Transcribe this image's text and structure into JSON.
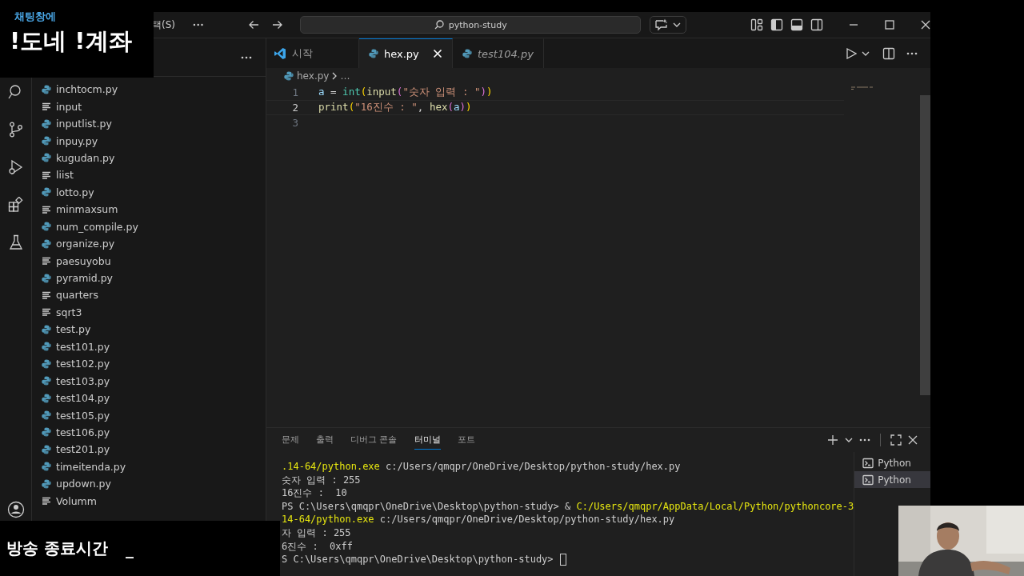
{
  "overlay_top": {
    "caption": "채팅창에",
    "headline": "!도네 !계좌"
  },
  "title_bar": {
    "menu_item": "택(S)",
    "search": "python-study"
  },
  "explorer": {
    "files": [
      {
        "name": "inchtocm.py",
        "kind": "python"
      },
      {
        "name": "input",
        "kind": "text"
      },
      {
        "name": "inputlist.py",
        "kind": "python"
      },
      {
        "name": "inpuy.py",
        "kind": "python"
      },
      {
        "name": "kugudan.py",
        "kind": "python"
      },
      {
        "name": "liist",
        "kind": "text"
      },
      {
        "name": "lotto.py",
        "kind": "python"
      },
      {
        "name": "minmaxsum",
        "kind": "text"
      },
      {
        "name": "num_compile.py",
        "kind": "python"
      },
      {
        "name": "organize.py",
        "kind": "python"
      },
      {
        "name": "paesuyobu",
        "kind": "text"
      },
      {
        "name": "pyramid.py",
        "kind": "python"
      },
      {
        "name": "quarters",
        "kind": "text"
      },
      {
        "name": "sqrt3",
        "kind": "text"
      },
      {
        "name": "test.py",
        "kind": "python"
      },
      {
        "name": "test101.py",
        "kind": "python"
      },
      {
        "name": "test102.py",
        "kind": "python"
      },
      {
        "name": "test103.py",
        "kind": "python"
      },
      {
        "name": "test104.py",
        "kind": "python"
      },
      {
        "name": "test105.py",
        "kind": "python"
      },
      {
        "name": "test106.py",
        "kind": "python"
      },
      {
        "name": "test201.py",
        "kind": "python"
      },
      {
        "name": "timeitenda.py",
        "kind": "python"
      },
      {
        "name": "updown.py",
        "kind": "python"
      },
      {
        "name": "Volumm",
        "kind": "text"
      }
    ]
  },
  "tabs": [
    {
      "label": "시작",
      "kind": "welcome",
      "selected": false,
      "preview": false
    },
    {
      "label": "hex.py",
      "kind": "python",
      "selected": true,
      "preview": false
    },
    {
      "label": "test104.py",
      "kind": "python",
      "selected": false,
      "preview": true
    }
  ],
  "breadcrumb": {
    "file": "hex.py",
    "rest": "…"
  },
  "code": {
    "lines": [
      {
        "number": "1",
        "selected": false,
        "tokens": [
          {
            "text": "a",
            "kind": "var"
          },
          {
            "text": " = ",
            "kind": "plain"
          },
          {
            "text": "int",
            "kind": "builtin"
          },
          {
            "text": "(",
            "kind": "bracket1"
          },
          {
            "text": "input",
            "kind": "func"
          },
          {
            "text": "(",
            "kind": "bracket2"
          },
          {
            "text": "\"숫자 입력 : \"",
            "kind": "string"
          },
          {
            "text": ")",
            "kind": "bracket2"
          },
          {
            "text": ")",
            "kind": "bracket1"
          }
        ]
      },
      {
        "number": "2",
        "selected": true,
        "tokens": [
          {
            "text": "print",
            "kind": "func"
          },
          {
            "text": "(",
            "kind": "bracket1"
          },
          {
            "text": "\"16진수 : \"",
            "kind": "string"
          },
          {
            "text": ", ",
            "kind": "plain"
          },
          {
            "text": "hex",
            "kind": "func"
          },
          {
            "text": "(",
            "kind": "bracket2"
          },
          {
            "text": "a",
            "kind": "var"
          },
          {
            "text": ")",
            "kind": "bracket2"
          },
          {
            "text": ")",
            "kind": "bracket1"
          }
        ]
      },
      {
        "number": "3",
        "selected": false
      }
    ]
  },
  "panel": {
    "tabs": [
      {
        "label": "문제",
        "selected": false
      },
      {
        "label": "출력",
        "selected": false
      },
      {
        "label": "디버그 콘솔",
        "selected": false
      },
      {
        "label": "터미널",
        "selected": true
      },
      {
        "label": "포트",
        "selected": false
      }
    ],
    "terminal_lines": [
      [
        {
          "text": ".14-64/python.exe",
          "kind": "path"
        },
        {
          "text": " c:/Users/qmqpr/OneDrive/Desktop/python-study/hex.py",
          "kind": "text"
        }
      ],
      [
        {
          "text": "숫자 입력 : 255",
          "kind": "text"
        }
      ],
      [
        {
          "text": "16진수 :  10",
          "kind": "text"
        }
      ],
      [
        {
          "text": "PS C:\\Users\\qmqpr\\OneDrive\\Desktop\\python-study> & ",
          "kind": "text"
        },
        {
          "text": "C:/Users/qmqpr/AppData/Local/Python/pythoncore-3",
          "kind": "path"
        }
      ],
      [
        {
          "text": "14-64/python.exe",
          "kind": "path"
        },
        {
          "text": " c:/Users/qmqpr/OneDrive/Desktop/python-study/hex.py",
          "kind": "text"
        }
      ],
      [
        {
          "text": "자 입력 : 255",
          "kind": "text"
        }
      ],
      [
        {
          "text": "6진수 :  0xff",
          "kind": "text"
        }
      ],
      [
        {
          "text": "S C:\\Users\\qmqpr\\OneDrive\\Desktop\\python-study> ",
          "kind": "text"
        }
      ]
    ],
    "cursor": true,
    "terminals": [
      {
        "label": "Python",
        "selected": false
      },
      {
        "label": "Python",
        "selected": true
      }
    ]
  },
  "overlay_bottom": {
    "label": "방송 종료시간",
    "cursor": "_"
  }
}
